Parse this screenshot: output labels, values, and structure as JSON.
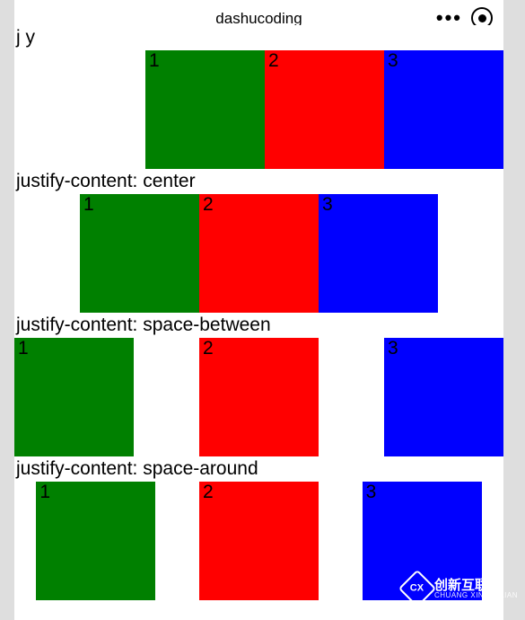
{
  "header": {
    "title": "dashucoding"
  },
  "partial_label_top": "j       y",
  "examples": [
    {
      "label": "",
      "boxes": [
        "1",
        "2",
        "3"
      ]
    },
    {
      "label": "justify-content: center",
      "boxes": [
        "1",
        "2",
        "3"
      ]
    },
    {
      "label": "justify-content: space-between",
      "boxes": [
        "1",
        "2",
        "3"
      ]
    },
    {
      "label": "justify-content: space-around",
      "boxes": [
        "1",
        "2",
        "3"
      ]
    }
  ],
  "colors": {
    "green": "#008000",
    "red": "#ff0000",
    "blue": "#0000ff"
  },
  "watermark": {
    "logo_letters": "CX",
    "line1": "创新互联",
    "line2": "CHUANG XIN HU LIAN"
  }
}
